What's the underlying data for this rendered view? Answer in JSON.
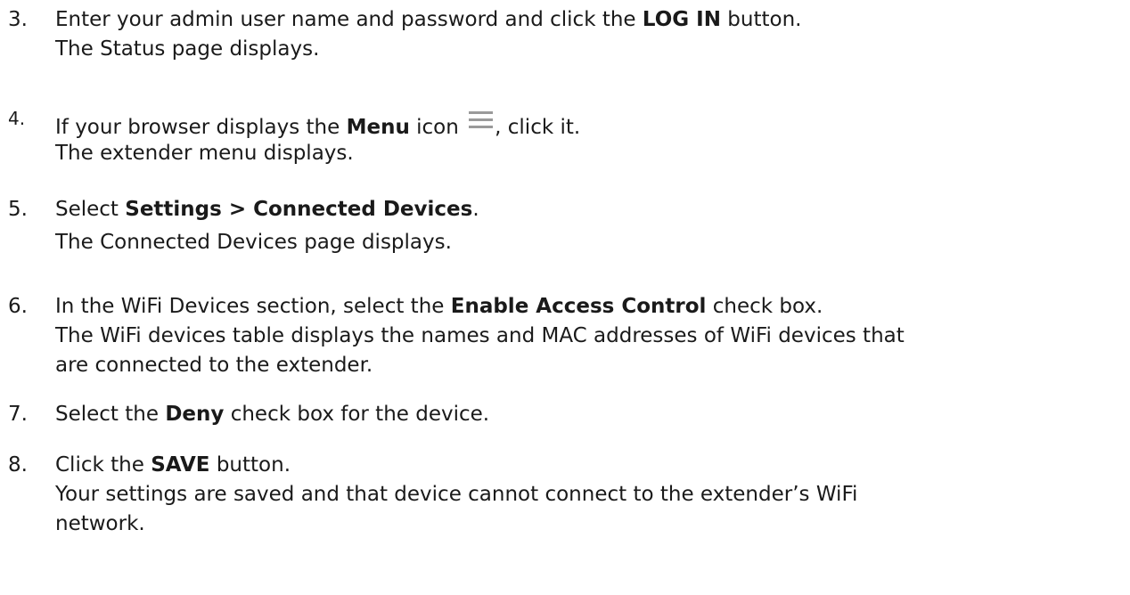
{
  "steps": [
    {
      "number": "3.",
      "line1": {
        "pre": "Enter your admin user name and password and click the ",
        "bold": "LOG IN",
        "post": " button."
      },
      "line2": "The Status page displays."
    },
    {
      "number": "4.",
      "line1": {
        "pre": "If your browser displays the ",
        "bold": "Menu",
        "mid": " icon ",
        "post": ", click it."
      },
      "icon": "menu-hamburger-icon",
      "line2": "The extender menu displays."
    },
    {
      "number": "5.",
      "line1": {
        "pre": "Select ",
        "bold": "Settings > Connected Devices",
        "post": "."
      },
      "line2": "The Connected Devices page displays."
    },
    {
      "number": "6.",
      "line1": {
        "pre": "In the WiFi Devices section, select the ",
        "bold": "Enable Access Control",
        "post": " check box."
      },
      "line2": "The WiFi devices table displays the names and MAC addresses of WiFi devices that",
      "line3": "are connected to the extender."
    },
    {
      "number": "7.",
      "line1": {
        "pre": "Select the ",
        "bold": "Deny",
        "post": " check box for the device."
      }
    },
    {
      "number": "8.",
      "line1": {
        "pre": "Click the ",
        "bold": "SAVE",
        "post": " button."
      },
      "line2": "Your settings are saved and that device cannot connect to the extender’s WiFi",
      "line3": "network."
    }
  ],
  "colors": {
    "text": "#1a1a1a",
    "icon": "#9a9a9a"
  }
}
